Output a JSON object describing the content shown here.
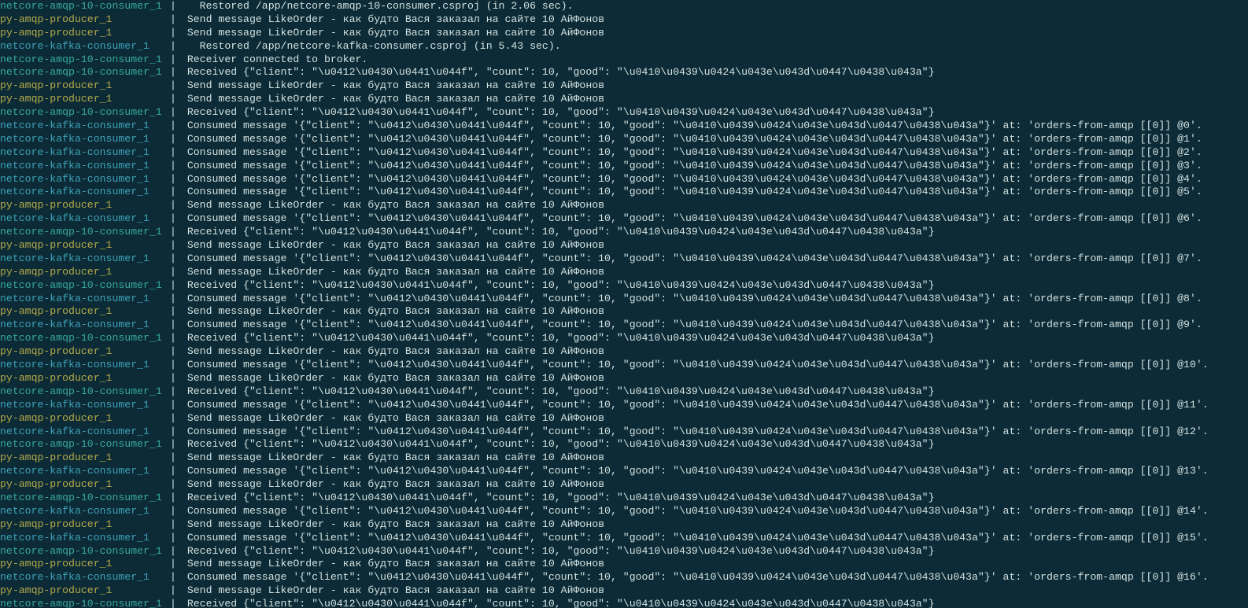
{
  "strings": {
    "restored_amqp": "  Restored /app/netcore-amqp-10-consumer.csproj (in 2.06 sec).",
    "restored_kafka": "  Restored /app/netcore-kafka-consumer.csproj (in 5.43 sec).",
    "broker": "Receiver connected to broker.",
    "send": "Send message LikeOrder - как будто Вася заказал на сайте 10 АйФонов",
    "recv": "Received {\"client\": \"\\u0412\\u0430\\u0441\\u044f\", \"count\": 10, \"good\": \"\\u0410\\u0439\\u0424\\u043e\\u043d\\u0447\\u0438\\u043a\"}",
    "cons": "Consumed message '{\"client\": \"\\u0412\\u0430\\u0441\\u044f\", \"count\": 10, \"good\": \"\\u0410\\u0439\\u0424\\u043e\\u043d\\u0447\\u0438\\u043a\"}' at: 'orders-from-amqp [[0]] @",
    "suffix": "'."
  },
  "containers": {
    "amqp": {
      "label": "netcore-amqp-10-consumer_1",
      "class": "c-teal1"
    },
    "prod": {
      "label": "py-amqp-producer_1",
      "class": "c-yellow"
    },
    "kafka": {
      "label": "netcore-kafka-consumer_1",
      "class": "c-cyan"
    }
  },
  "lines": [
    {
      "c": "amqp",
      "m": "restored_amqp"
    },
    {
      "c": "prod",
      "m": "send"
    },
    {
      "c": "prod",
      "m": "send"
    },
    {
      "c": "kafka",
      "m": "restored_kafka"
    },
    {
      "c": "amqp",
      "m": "broker"
    },
    {
      "c": "amqp",
      "m": "recv"
    },
    {
      "c": "prod",
      "m": "send"
    },
    {
      "c": "prod",
      "m": "send"
    },
    {
      "c": "amqp",
      "m": "recv"
    },
    {
      "c": "kafka",
      "m": "cons",
      "n": 0
    },
    {
      "c": "kafka",
      "m": "cons",
      "n": 1
    },
    {
      "c": "kafka",
      "m": "cons",
      "n": 2
    },
    {
      "c": "kafka",
      "m": "cons",
      "n": 3
    },
    {
      "c": "kafka",
      "m": "cons",
      "n": 4
    },
    {
      "c": "kafka",
      "m": "cons",
      "n": 5
    },
    {
      "c": "prod",
      "m": "send"
    },
    {
      "c": "kafka",
      "m": "cons",
      "n": 6
    },
    {
      "c": "amqp",
      "m": "recv"
    },
    {
      "c": "prod",
      "m": "send"
    },
    {
      "c": "kafka",
      "m": "cons",
      "n": 7
    },
    {
      "c": "prod",
      "m": "send"
    },
    {
      "c": "amqp",
      "m": "recv"
    },
    {
      "c": "kafka",
      "m": "cons",
      "n": 8
    },
    {
      "c": "prod",
      "m": "send"
    },
    {
      "c": "kafka",
      "m": "cons",
      "n": 9
    },
    {
      "c": "amqp",
      "m": "recv"
    },
    {
      "c": "prod",
      "m": "send"
    },
    {
      "c": "kafka",
      "m": "cons",
      "n": 10
    },
    {
      "c": "prod",
      "m": "send"
    },
    {
      "c": "amqp",
      "m": "recv"
    },
    {
      "c": "kafka",
      "m": "cons",
      "n": 11
    },
    {
      "c": "prod",
      "m": "send"
    },
    {
      "c": "kafka",
      "m": "cons",
      "n": 12
    },
    {
      "c": "amqp",
      "m": "recv"
    },
    {
      "c": "prod",
      "m": "send"
    },
    {
      "c": "kafka",
      "m": "cons",
      "n": 13
    },
    {
      "c": "prod",
      "m": "send"
    },
    {
      "c": "amqp",
      "m": "recv"
    },
    {
      "c": "kafka",
      "m": "cons",
      "n": 14
    },
    {
      "c": "prod",
      "m": "send"
    },
    {
      "c": "kafka",
      "m": "cons",
      "n": 15
    },
    {
      "c": "amqp",
      "m": "recv"
    },
    {
      "c": "prod",
      "m": "send"
    },
    {
      "c": "kafka",
      "m": "cons",
      "n": 16
    },
    {
      "c": "prod",
      "m": "send"
    },
    {
      "c": "amqp",
      "m": "recv"
    }
  ]
}
